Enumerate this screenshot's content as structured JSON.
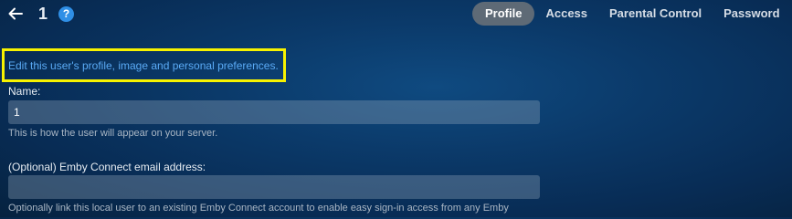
{
  "header": {
    "title": "1",
    "help_symbol": "?",
    "back_icon": "arrow-left-icon"
  },
  "tabs": [
    {
      "label": "Profile",
      "active": true
    },
    {
      "label": "Access",
      "active": false
    },
    {
      "label": "Parental Control",
      "active": false
    },
    {
      "label": "Password",
      "active": false
    }
  ],
  "main": {
    "description": "Edit this user's profile, image and personal preferences.",
    "name_label": "Name:",
    "name_value": "1",
    "name_help": "This is how the user will appear on your server.",
    "email_label": "(Optional) Emby Connect email address:",
    "email_value": "",
    "email_help": "Optionally link this local user to an existing Emby Connect account to enable easy sign-in access from any Emby"
  },
  "colors": {
    "accent": "#2f8fe6",
    "highlight_box": "#f7f200",
    "link_text": "#5aaaf5",
    "active_tab_bg": "#5e6a76"
  }
}
